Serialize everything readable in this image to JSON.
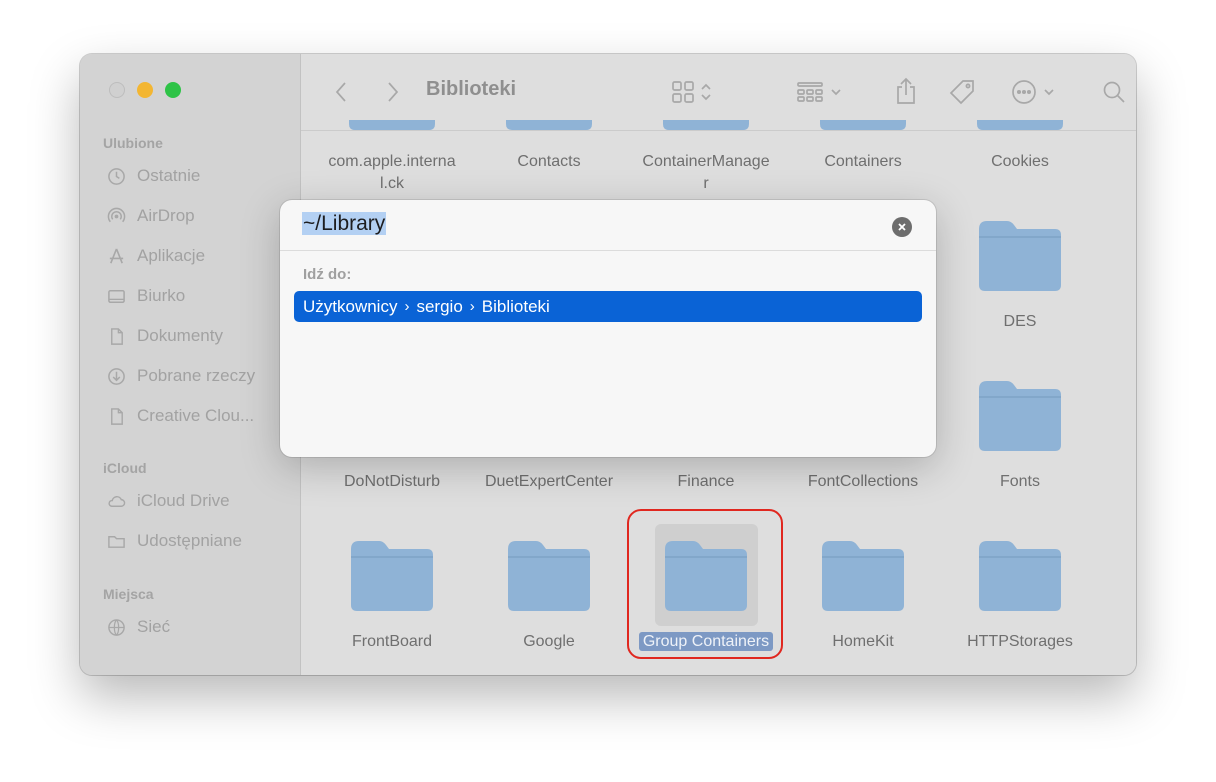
{
  "window": {
    "title": "Biblioteki"
  },
  "sidebar": {
    "sections": [
      {
        "label": "Ulubione",
        "items": [
          {
            "label": "Ostatnie",
            "icon": "clock-icon"
          },
          {
            "label": "AirDrop",
            "icon": "airdrop-icon"
          },
          {
            "label": "Aplikacje",
            "icon": "applications-icon"
          },
          {
            "label": "Biurko",
            "icon": "desktop-icon"
          },
          {
            "label": "Dokumenty",
            "icon": "document-icon"
          },
          {
            "label": "Pobrane rzeczy",
            "icon": "download-icon"
          },
          {
            "label": "Creative Clou...",
            "icon": "document-icon"
          }
        ]
      },
      {
        "label": "iCloud",
        "items": [
          {
            "label": "iCloud Drive",
            "icon": "cloud-icon"
          },
          {
            "label": "Udostępniane",
            "icon": "shared-folder-icon"
          }
        ]
      },
      {
        "label": "Miejsca",
        "items": [
          {
            "label": "Sieć",
            "icon": "globe-icon"
          }
        ]
      }
    ]
  },
  "files": {
    "row1": [
      "com.apple.interna l.ck",
      "Contacts",
      "ContainerManager",
      "Containers",
      "Cookies"
    ],
    "row1_lines": [
      [
        "com.apple.interna",
        "l.ck"
      ],
      [
        "Contacts"
      ],
      [
        "ContainerManage",
        "r"
      ],
      [
        "Containers"
      ],
      [
        "Cookies"
      ]
    ],
    "row2_right": "DES",
    "row3": [
      "DoNotDisturb",
      "DuetExpertCenter",
      "Finance",
      "FontCollections",
      "Fonts"
    ],
    "row4": [
      "FrontBoard",
      "Google",
      "Group Containers",
      "HomeKit",
      "HTTPStorages"
    ],
    "selected": "Group Containers",
    "folder_color": "#8fb3d6"
  },
  "goto_dialog": {
    "input_value": "~/Library",
    "section_label": "Idź do:",
    "suggestion": {
      "parts": [
        "Użytkownicy",
        "sergio",
        "Biblioteki"
      ],
      "separator": "›"
    },
    "accent_color": "#0a63d6"
  },
  "annotation": {
    "highlight_color": "#e0271f"
  }
}
